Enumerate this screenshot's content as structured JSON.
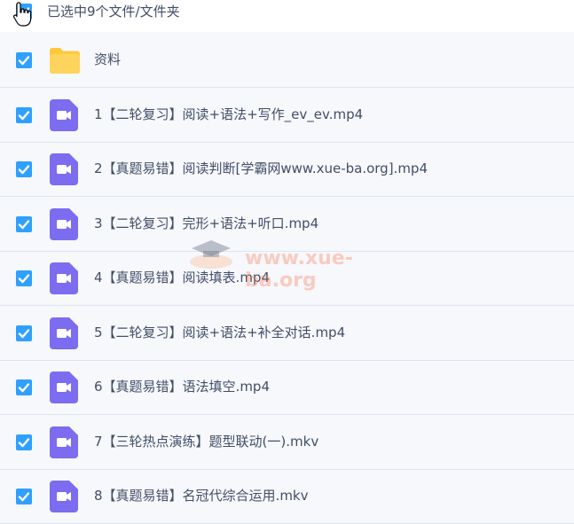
{
  "header": {
    "selection_text": "已选中9个文件/文件夹"
  },
  "files": [
    {
      "name": "资料",
      "type": "folder-icon"
    },
    {
      "name": "1【二轮复习】阅读+语法+写作_ev_ev.mp4",
      "type": "video-icon"
    },
    {
      "name": "2【真题易错】阅读判断[学霸网www.xue-ba.org].mp4",
      "type": "video-icon"
    },
    {
      "name": "3【二轮复习】完形+语法+听口.mp4",
      "type": "video-icon"
    },
    {
      "name": "4【真题易错】阅读填表.mp4",
      "type": "video-icon"
    },
    {
      "name": "5【二轮复习】阅读+语法+补全对话.mp4",
      "type": "video-icon"
    },
    {
      "name": "6【真题易错】语法填空.mp4",
      "type": "video-icon"
    },
    {
      "name": "7【三轮热点演练】题型联动(一).mkv",
      "type": "video-icon"
    },
    {
      "name": "8【真题易错】名冠代综合运用.mkv",
      "type": "video-icon"
    }
  ],
  "watermark": {
    "text": "www.xue-ba.org"
  },
  "colors": {
    "checkbox": "#2fa0ff",
    "video_icon": "#7c6cf0",
    "folder_icon": "#ffc93e",
    "row_border": "#dde5f1"
  }
}
